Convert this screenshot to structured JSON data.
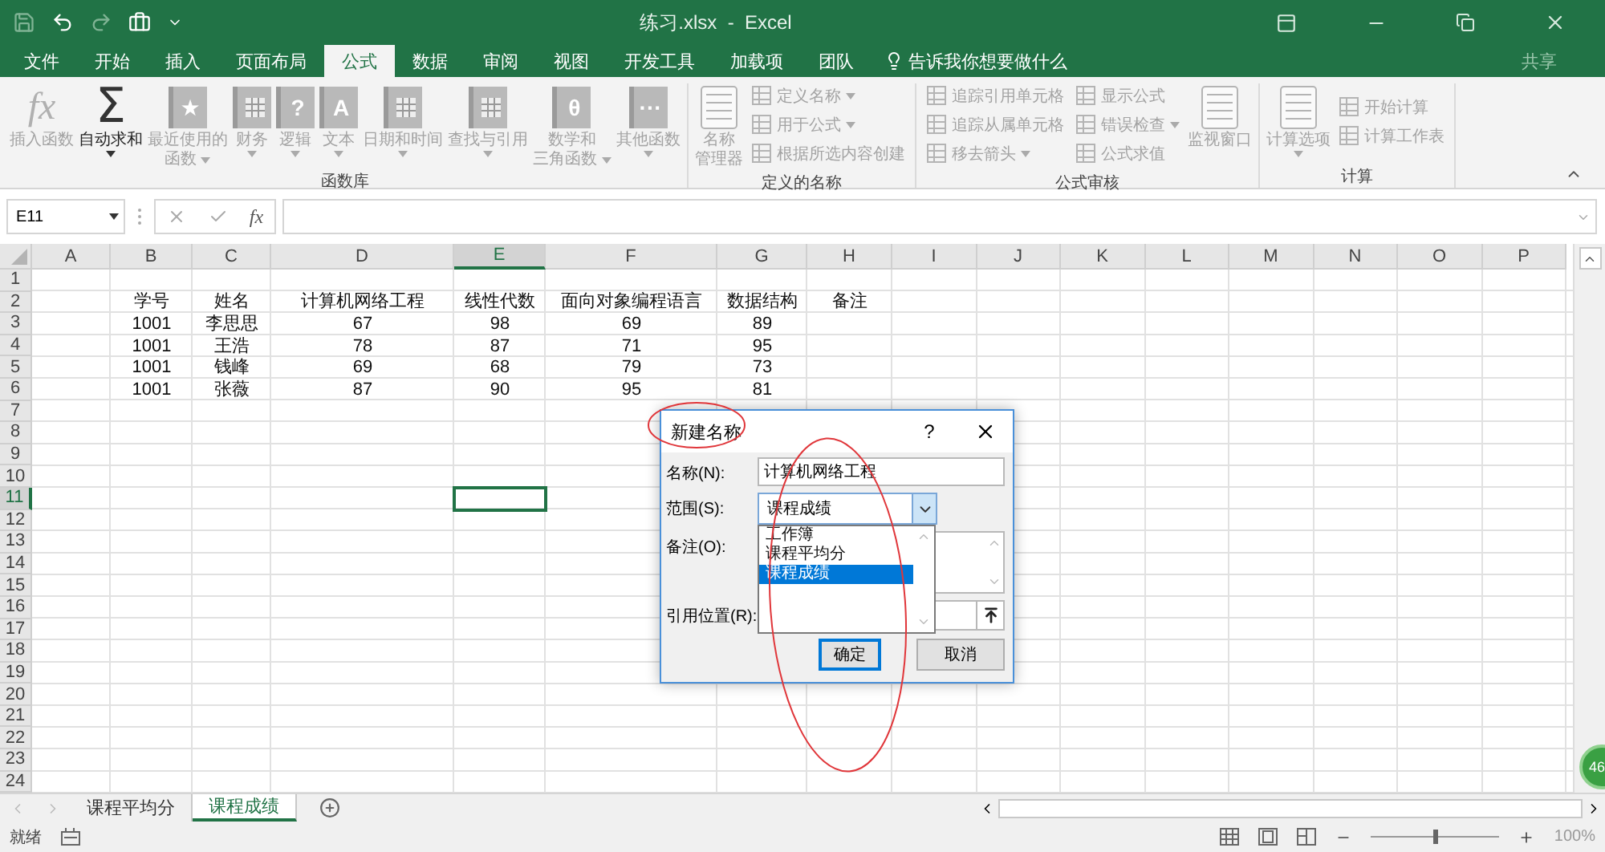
{
  "title_bar": {
    "title": "练习.xlsx  -  Excel"
  },
  "ribbon_tabs": [
    {
      "label": "文件",
      "selected": false
    },
    {
      "label": "开始",
      "selected": false
    },
    {
      "label": "插入",
      "selected": false
    },
    {
      "label": "页面布局",
      "selected": false
    },
    {
      "label": "公式",
      "selected": true
    },
    {
      "label": "数据",
      "selected": false
    },
    {
      "label": "审阅",
      "selected": false
    },
    {
      "label": "视图",
      "selected": false
    },
    {
      "label": "开发工具",
      "selected": false
    },
    {
      "label": "加载项",
      "selected": false
    },
    {
      "label": "团队",
      "selected": false
    }
  ],
  "tell_me": {
    "placeholder": "告诉我你想要做什么"
  },
  "share": "共享",
  "ribbon_groups": [
    {
      "label": "函数库",
      "buttons": [
        {
          "kind": "plain",
          "lines": [
            "插入函数"
          ],
          "glyph": "fx",
          "disabled": true,
          "dropdown": false
        },
        {
          "kind": "plain",
          "lines": [
            "自动求和"
          ],
          "glyph": "Σ",
          "disabled": false,
          "dropdown": true
        },
        {
          "kind": "book",
          "lines": [
            "最近使用的",
            "函数"
          ],
          "glyph": "★",
          "disabled": true,
          "dropdown": true
        },
        {
          "kind": "book",
          "lines": [
            "财务"
          ],
          "disabled": true,
          "dropdown": true
        },
        {
          "kind": "book",
          "lines": [
            "逻辑"
          ],
          "glyph": "?",
          "disabled": true,
          "dropdown": true
        },
        {
          "kind": "book",
          "lines": [
            "文本"
          ],
          "glyph": "A",
          "disabled": true,
          "dropdown": true
        },
        {
          "kind": "book",
          "lines": [
            "日期和时间"
          ],
          "disabled": true,
          "dropdown": true
        },
        {
          "kind": "book",
          "lines": [
            "查找与引用"
          ],
          "disabled": true,
          "dropdown": true
        },
        {
          "kind": "book",
          "lines": [
            "数学和",
            "三角函数"
          ],
          "glyph": "θ",
          "disabled": true,
          "dropdown": true
        },
        {
          "kind": "book",
          "lines": [
            "其他函数"
          ],
          "glyph": "···",
          "disabled": true,
          "dropdown": true
        }
      ]
    },
    {
      "label": "定义的名称",
      "buttons": [
        {
          "kind": "tool",
          "lines": [
            "名称",
            "管理器"
          ],
          "disabled": true,
          "dropdown": false
        },
        {
          "kind": "small",
          "lines": [
            "定义名称"
          ],
          "disabled": true,
          "dropdown": true
        },
        {
          "kind": "small",
          "lines": [
            "用于公式"
          ],
          "disabled": true,
          "dropdown": true
        },
        {
          "kind": "small",
          "lines": [
            "根据所选内容创建"
          ],
          "disabled": true,
          "dropdown": false
        }
      ]
    },
    {
      "label": "公式审核",
      "buttons": [
        {
          "kind": "small",
          "lines": [
            "追踪引用单元格"
          ],
          "disabled": true,
          "dropdown": false
        },
        {
          "kind": "small",
          "lines": [
            "追踪从属单元格"
          ],
          "disabled": true,
          "dropdown": false
        },
        {
          "kind": "small",
          "lines": [
            "移去箭头"
          ],
          "disabled": true,
          "dropdown": true
        },
        {
          "kind": "small",
          "lines": [
            "显示公式"
          ],
          "disabled": true,
          "dropdown": false
        },
        {
          "kind": "small",
          "lines": [
            "错误检查"
          ],
          "disabled": true,
          "dropdown": true
        },
        {
          "kind": "small",
          "lines": [
            "公式求值"
          ],
          "disabled": true,
          "dropdown": false
        },
        {
          "kind": "tool",
          "lines": [
            "监视窗口"
          ],
          "disabled": true,
          "dropdown": false
        }
      ]
    },
    {
      "label": "计算",
      "buttons": [
        {
          "kind": "tool",
          "lines": [
            "计算选项"
          ],
          "disabled": true,
          "dropdown": true
        },
        {
          "kind": "small",
          "lines": [
            "开始计算"
          ],
          "disabled": true,
          "dropdown": false
        },
        {
          "kind": "small",
          "lines": [
            "计算工作表"
          ],
          "disabled": true,
          "dropdown": false
        }
      ]
    }
  ],
  "formula_bar": {
    "name_box": "E11",
    "fx": "fx"
  },
  "sheet": {
    "columns": [
      {
        "label": "A",
        "selected": false
      },
      {
        "label": "B",
        "selected": false
      },
      {
        "label": "C",
        "selected": false
      },
      {
        "label": "D",
        "selected": false
      },
      {
        "label": "E",
        "selected": true
      },
      {
        "label": "F",
        "selected": false
      },
      {
        "label": "G",
        "selected": false
      },
      {
        "label": "H",
        "selected": false
      },
      {
        "label": "I",
        "selected": false
      },
      {
        "label": "J",
        "selected": false
      },
      {
        "label": "K",
        "selected": false
      },
      {
        "label": "L",
        "selected": false
      },
      {
        "label": "M",
        "selected": false
      },
      {
        "label": "N",
        "selected": false
      },
      {
        "label": "O",
        "selected": false
      },
      {
        "label": "P",
        "selected": false
      }
    ],
    "rows": [
      {
        "label": "1",
        "selected": false
      },
      {
        "label": "2",
        "selected": false,
        "cells": {
          "B": "学号",
          "C": "姓名",
          "D": "计算机网络工程",
          "E": "线性代数",
          "F": "面向对象编程语言",
          "G": "数据结构",
          "H": "备注"
        }
      },
      {
        "label": "3",
        "selected": false,
        "cells": {
          "B": "1001",
          "C": "李思思",
          "D": "67",
          "E": "98",
          "F": "69",
          "G": "89"
        }
      },
      {
        "label": "4",
        "selected": false,
        "cells": {
          "B": "1001",
          "C": "王浩",
          "D": "78",
          "E": "87",
          "F": "71",
          "G": "95"
        }
      },
      {
        "label": "5",
        "selected": false,
        "cells": {
          "B": "1001",
          "C": "钱峰",
          "D": "69",
          "E": "68",
          "F": "79",
          "G": "73"
        }
      },
      {
        "label": "6",
        "selected": false,
        "cells": {
          "B": "1001",
          "C": "张薇",
          "D": "87",
          "E": "90",
          "F": "95",
          "G": "81"
        }
      },
      {
        "label": "7",
        "selected": false
      },
      {
        "label": "8",
        "selected": false
      },
      {
        "label": "9",
        "selected": false
      },
      {
        "label": "10",
        "selected": false
      },
      {
        "label": "11",
        "selected": true
      },
      {
        "label": "12",
        "selected": false
      },
      {
        "label": "13",
        "selected": false
      },
      {
        "label": "14",
        "selected": false
      },
      {
        "label": "15",
        "selected": false
      },
      {
        "label": "16",
        "selected": false
      },
      {
        "label": "17",
        "selected": false
      },
      {
        "label": "18",
        "selected": false
      },
      {
        "label": "19",
        "selected": false
      },
      {
        "label": "20",
        "selected": false
      },
      {
        "label": "21",
        "selected": false
      },
      {
        "label": "22",
        "selected": false
      },
      {
        "label": "23",
        "selected": false
      },
      {
        "label": "24",
        "selected": false
      }
    ]
  },
  "sheet_tabs": [
    {
      "label": "课程平均分",
      "selected": false
    },
    {
      "label": "课程成绩",
      "selected": true
    }
  ],
  "status_bar": {
    "status": "就绪",
    "zoom": "100%",
    "zoom_slider": {
      "level": 0.5
    }
  },
  "dialog": {
    "title": "新建名称",
    "help": "?",
    "fields": [
      {
        "kind": "text",
        "label": "名称(N):",
        "value": "计算机网络工程"
      },
      {
        "kind": "combo",
        "label": "范围(S):",
        "value": "课程成绩",
        "expanded": true,
        "options": [
          {
            "label": "工作簿",
            "selected": false
          },
          {
            "label": "课程平均分",
            "selected": false
          },
          {
            "label": "课程成绩",
            "selected": true
          }
        ]
      },
      {
        "kind": "memo",
        "label": "备注(O):"
      },
      {
        "kind": "ref",
        "label": "引用位置(R):"
      }
    ],
    "buttons": [
      {
        "label": "确定",
        "default": true
      },
      {
        "label": "取消",
        "default": false
      }
    ]
  },
  "floating_widget": {
    "text": "46"
  }
}
